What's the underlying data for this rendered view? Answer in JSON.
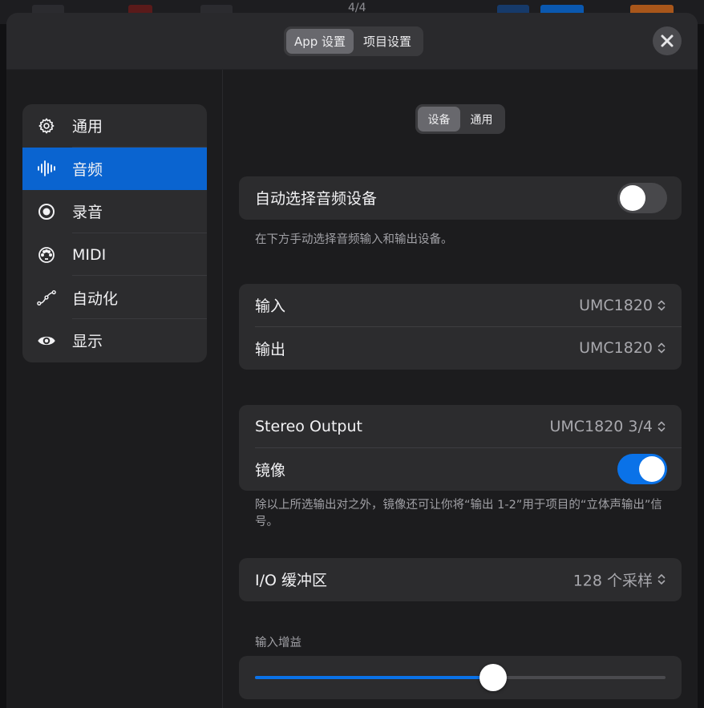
{
  "background": {
    "time_signature": "4/4"
  },
  "header": {
    "tabs": [
      {
        "label": "App 设置",
        "active": true
      },
      {
        "label": "项目设置",
        "active": false
      }
    ]
  },
  "sidebar": {
    "items": [
      {
        "label": "通用",
        "icon": "gear-icon",
        "active": false
      },
      {
        "label": "音频",
        "icon": "waveform-icon",
        "active": true
      },
      {
        "label": "录音",
        "icon": "record-icon",
        "active": false
      },
      {
        "label": "MIDI",
        "icon": "midi-port-icon",
        "active": false
      },
      {
        "label": "自动化",
        "icon": "automation-curve-icon",
        "active": false
      },
      {
        "label": "显示",
        "icon": "eye-icon",
        "active": false
      }
    ]
  },
  "content": {
    "subtabs": [
      {
        "label": "设备",
        "active": true
      },
      {
        "label": "通用",
        "active": false
      }
    ],
    "auto_select": {
      "label": "自动选择音频设备",
      "enabled": false
    },
    "auto_select_note": "在下方手动选择音频输入和输出设备。",
    "input": {
      "label": "输入",
      "value": "UMC1820"
    },
    "output": {
      "label": "输出",
      "value": "UMC1820"
    },
    "stereo_output": {
      "label": "Stereo Output",
      "value": "UMC1820 3/4"
    },
    "mirror": {
      "label": "镜像",
      "enabled": true
    },
    "mirror_note": "除以上所选输出对之外，镜像还可让你将“输出 1-2”用于项目的“立体声输出”信号。",
    "io_buffer": {
      "label": "I/O 缓冲区",
      "value": "128 个采样"
    },
    "input_gain": {
      "label": "输入增益",
      "level": 0.58
    }
  },
  "colors": {
    "accent": "#0a64d0",
    "toggle_on": "#0a72e8",
    "panel": "#2c2c2e"
  }
}
